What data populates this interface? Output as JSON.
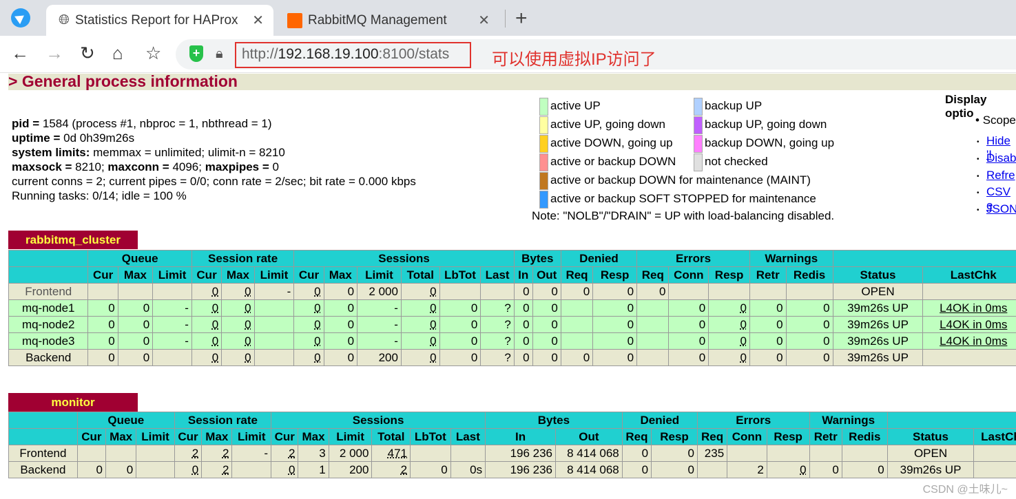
{
  "browser": {
    "tab1_title": "Statistics Report for HAProx",
    "tab2_title": "RabbitMQ Management",
    "url_scheme": "http://",
    "url_host": "192.168.19.100",
    "url_rest": ":8100/stats",
    "annotation": "可以使用虚拟IP访问了"
  },
  "header": {
    "title": "> General process information"
  },
  "process": {
    "pid_label": "pid = ",
    "pid_value": "1584 (process #1, nbproc = 1, nbthread = 1)",
    "uptime_label": "uptime = ",
    "uptime_value": "0d 0h39m26s",
    "limits_label": "system limits:",
    "limits_value": " memmax = unlimited; ulimit-n = 8210",
    "maxsock_label": "maxsock = ",
    "maxsock_value": "8210; ",
    "maxconn_label": "maxconn = ",
    "maxconn_value": "4096; ",
    "maxpipes_label": "maxpipes = ",
    "maxpipes_value": "0",
    "conns": "current conns = 2; current pipes = 0/0; conn rate = 2/sec; bit rate = 0.000 kbps",
    "tasks": "Running tasks: 0/14; idle = 100 %"
  },
  "legend": [
    {
      "text": "active UP",
      "color": "#c0ffc0"
    },
    {
      "text": "active UP, going down",
      "color": "#ffffa0"
    },
    {
      "text": "active DOWN, going up",
      "color": "#ffd020"
    },
    {
      "text": "active or backup DOWN",
      "color": "#ff9090"
    },
    {
      "text": "active or backup DOWN for maintenance (MAINT)",
      "color": "#c07820"
    },
    {
      "text": "active or backup SOFT STOPPED for maintenance",
      "color": "#3399ff"
    },
    {
      "text": "backup UP",
      "color": "#b0d0ff"
    },
    {
      "text": "backup UP, going down",
      "color": "#c060ff"
    },
    {
      "text": "backup DOWN, going up",
      "color": "#ff80ff"
    },
    {
      "text": "not checked",
      "color": "#e0e0e0"
    }
  ],
  "legend_note": "Note: \"NOLB\"/\"DRAIN\" = UP with load-balancing disabled.",
  "display": {
    "title": "Display optio",
    "scope": "Scope",
    "links": [
      "Hide 'I",
      "Disabl",
      "Refre",
      "CSV e",
      "JSON"
    ]
  },
  "groups1": [
    "",
    "Queue",
    "Session rate",
    "Sessions",
    "Bytes",
    "Denied",
    "Errors",
    "Warnings",
    ""
  ],
  "cols1": [
    "",
    "Cur",
    "Max",
    "Limit",
    "Cur",
    "Max",
    "Limit",
    "Cur",
    "Max",
    "Limit",
    "Total",
    "LbTot",
    "Last",
    "In",
    "Out",
    "Req",
    "Resp",
    "Req",
    "Conn",
    "Resp",
    "Retr",
    "Redis",
    "Status",
    "LastChk"
  ],
  "proxy1": {
    "name": "rabbitmq_cluster",
    "rows": [
      [
        "Frontend",
        "",
        "",
        "",
        "0",
        "0",
        "-",
        "0",
        "0",
        "2 000",
        "0",
        "",
        "",
        "0",
        "0",
        "0",
        "0",
        "0",
        "",
        "",
        "",
        "",
        "OPEN",
        ""
      ],
      [
        "mq-node1",
        "0",
        "0",
        "-",
        "0",
        "0",
        "",
        "0",
        "0",
        "-",
        "0",
        "0",
        "?",
        "0",
        "0",
        "",
        "0",
        "",
        "0",
        "0",
        "0",
        "0",
        "39m26s UP",
        "L4OK in 0ms"
      ],
      [
        "mq-node2",
        "0",
        "0",
        "-",
        "0",
        "0",
        "",
        "0",
        "0",
        "-",
        "0",
        "0",
        "?",
        "0",
        "0",
        "",
        "0",
        "",
        "0",
        "0",
        "0",
        "0",
        "39m26s UP",
        "L4OK in 0ms"
      ],
      [
        "mq-node3",
        "0",
        "0",
        "-",
        "0",
        "0",
        "",
        "0",
        "0",
        "-",
        "0",
        "0",
        "?",
        "0",
        "0",
        "",
        "0",
        "",
        "0",
        "0",
        "0",
        "0",
        "39m26s UP",
        "L4OK in 0ms"
      ],
      [
        "Backend",
        "0",
        "0",
        "",
        "0",
        "0",
        "",
        "0",
        "0",
        "200",
        "0",
        "0",
        "?",
        "0",
        "0",
        "0",
        "0",
        "",
        "0",
        "0",
        "0",
        "0",
        "39m26s UP",
        ""
      ]
    ]
  },
  "cols2": [
    "",
    "Cur",
    "Max",
    "Limit",
    "Cur",
    "Max",
    "Limit",
    "Cur",
    "Max",
    "Limit",
    "Total",
    "LbTot",
    "Last",
    "In",
    "Out",
    "Req",
    "Resp",
    "Req",
    "Conn",
    "Resp",
    "Retr",
    "Redis",
    "Status",
    "LastChk"
  ],
  "proxy2": {
    "name": "monitor",
    "rows": [
      [
        "Frontend",
        "",
        "",
        "",
        "2",
        "2",
        "-",
        "2",
        "3",
        "2 000",
        "471",
        "",
        "",
        "196 236",
        "8 414 068",
        "0",
        "0",
        "235",
        "",
        "",
        "",
        "",
        "OPEN",
        ""
      ],
      [
        "Backend",
        "0",
        "0",
        "",
        "0",
        "2",
        "",
        "0",
        "1",
        "200",
        "2",
        "0",
        "0s",
        "196 236",
        "8 414 068",
        "0",
        "0",
        "",
        "2",
        "0",
        "0",
        "0",
        "39m26s UP",
        ""
      ]
    ]
  },
  "watermark": "CSDN @土味儿~"
}
